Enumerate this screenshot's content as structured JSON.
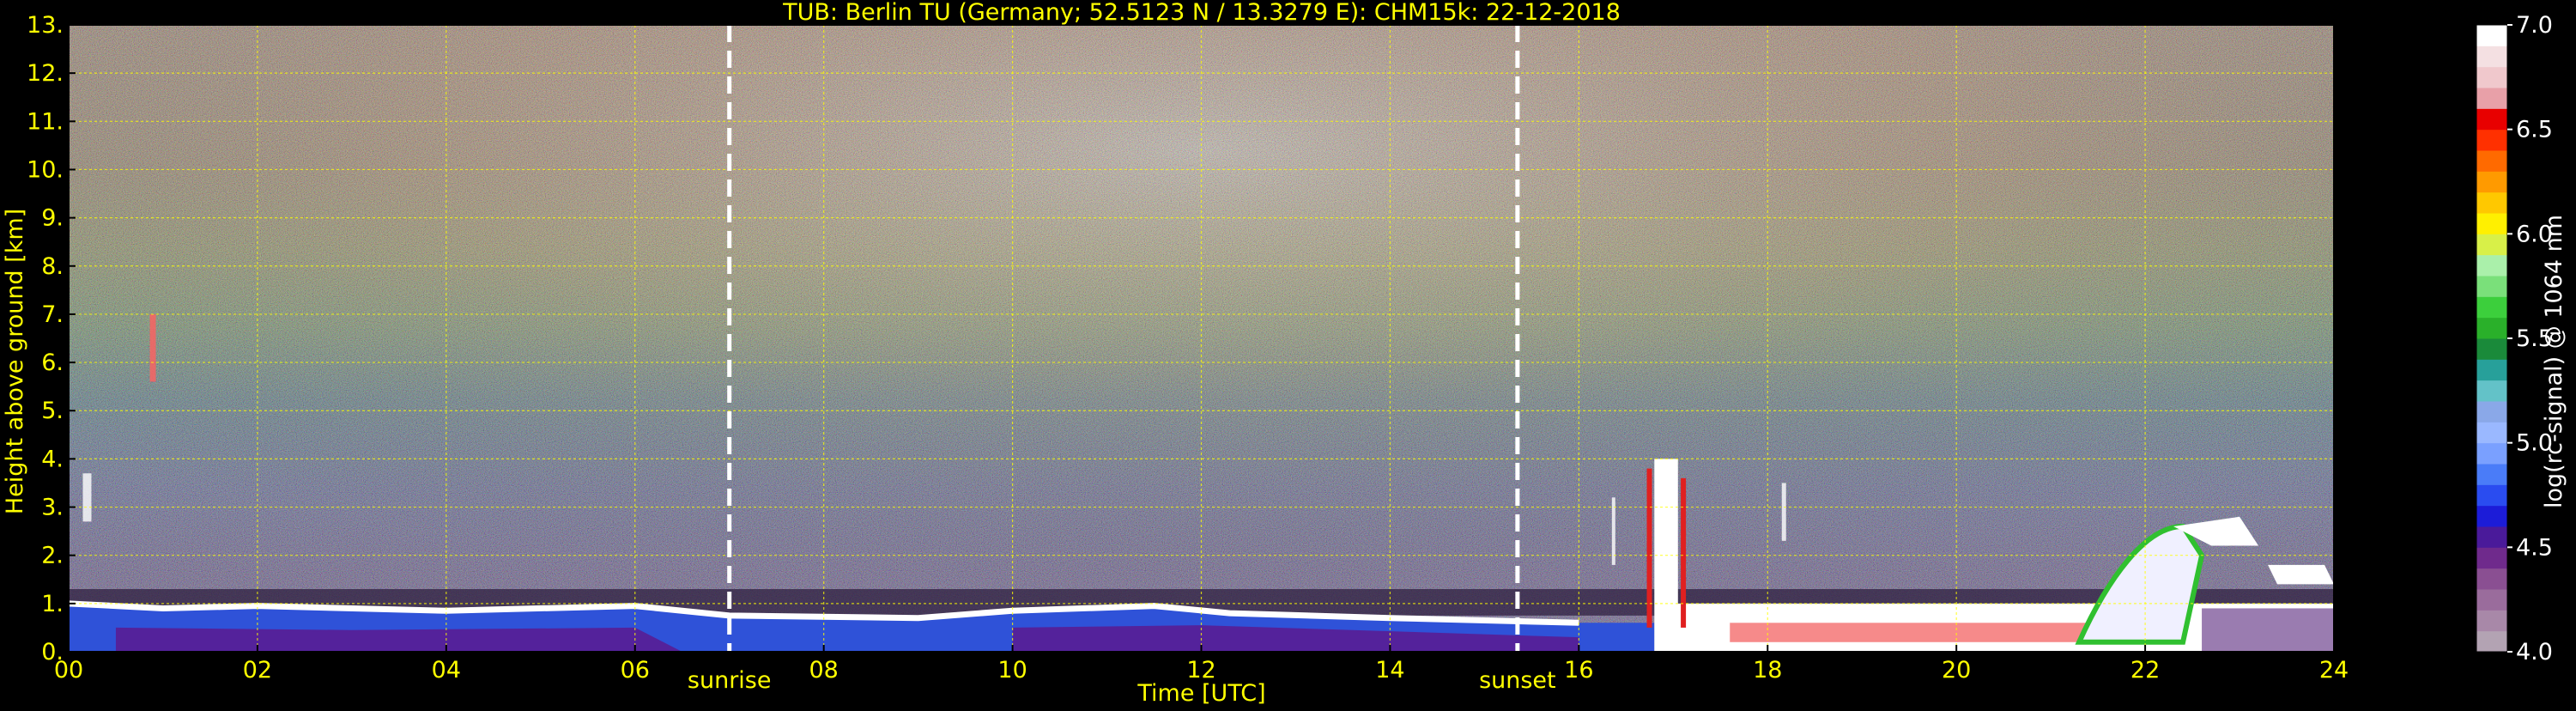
{
  "chart_data": {
    "type": "heatmap",
    "title": "TUB: Berlin TU (Germany; 52.5123 N / 13.3279 E):    CHM15k: 22-12-2018",
    "xlabel": "Time [UTC]",
    "ylabel": "Height above ground [km]",
    "xlim": [
      0,
      24
    ],
    "ylim": [
      0,
      13
    ],
    "x_ticks": [
      "00",
      "02",
      "04",
      "06",
      "08",
      "10",
      "12",
      "14",
      "16",
      "18",
      "20",
      "22",
      "24"
    ],
    "y_ticks": [
      "0.",
      "1.",
      "2.",
      "3.",
      "4.",
      "5.",
      "6.",
      "7.",
      "8.",
      "9.",
      "10.",
      "11.",
      "12.",
      "13."
    ],
    "grid": true,
    "annotations": [
      {
        "label": "sunrise",
        "x": 7.0
      },
      {
        "label": "sunset",
        "x": 15.35
      }
    ],
    "colorbar": {
      "label": "log(rc-signal) @ 1064 nm",
      "range": [
        4.0,
        7.0
      ],
      "ticks": [
        "4.0",
        "4.5",
        "5.0",
        "5.5",
        "6.0",
        "6.5",
        "7.0"
      ],
      "colors": [
        "#b3a3b3",
        "#a888a8",
        "#9a6c9c",
        "#8a4f92",
        "#6f2a8c",
        "#4a1a9a",
        "#1c1cd8",
        "#2a4cf0",
        "#4a7cf8",
        "#7aa0ff",
        "#9ab8ff",
        "#8aa8e8",
        "#63c2c8",
        "#27a09a",
        "#1a8a3a",
        "#2ab02a",
        "#3ccf3c",
        "#7ae07a",
        "#aaf0aa",
        "#d8f048",
        "#fff000",
        "#ffc800",
        "#ff9a00",
        "#ff6a00",
        "#ff3000",
        "#e80000",
        "#e8a0a8",
        "#f0c8cc",
        "#f4e0e2",
        "#ffffff"
      ]
    }
  }
}
